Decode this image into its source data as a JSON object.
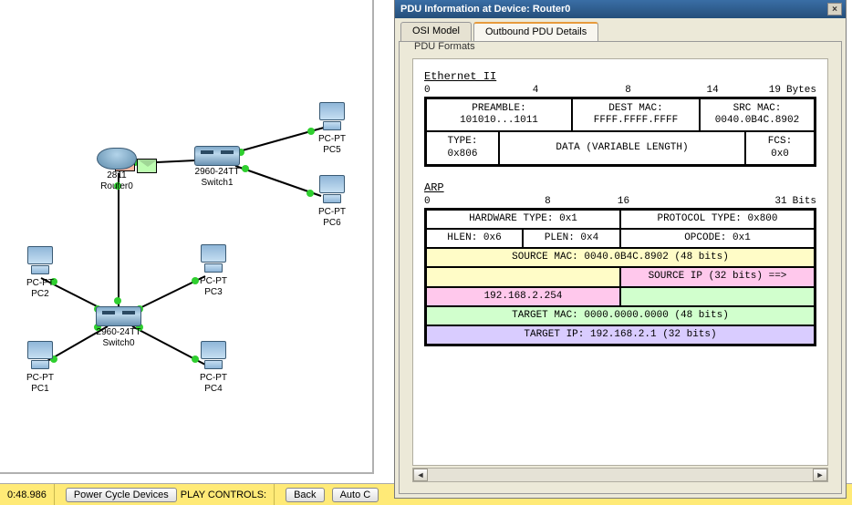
{
  "window": {
    "title": "PDU Information at Device: Router0",
    "close_glyph": "×"
  },
  "tabs": {
    "osi": "OSI Model",
    "outbound": "Outbound PDU Details"
  },
  "fieldset_label": "PDU Formats",
  "ethernet": {
    "title": "Ethernet II",
    "ticks": [
      "0",
      "4",
      "8",
      "14",
      "19"
    ],
    "unit": "Bytes",
    "preamble_label": "PREAMBLE:",
    "preamble_value": "101010...1011",
    "destmac_label": "DEST MAC:",
    "destmac_value": "FFFF.FFFF.FFFF",
    "srcmac_label": "SRC MAC:",
    "srcmac_value": "0040.0B4C.8902",
    "type_label": "TYPE:",
    "type_value": "0x806",
    "data_label": "DATA (VARIABLE LENGTH)",
    "fcs_label": "FCS:",
    "fcs_value": "0x0"
  },
  "arp": {
    "title": "ARP",
    "ticks": [
      "0",
      "8",
      "16",
      "31"
    ],
    "unit": "Bits",
    "hw_type": "HARDWARE TYPE: 0x1",
    "proto_type": "PROTOCOL TYPE: 0x800",
    "hlen": "HLEN: 0x6",
    "plen": "PLEN: 0x4",
    "opcode": "OPCODE: 0x1",
    "src_mac": "SOURCE MAC: 0040.0B4C.8902 (48 bits)",
    "src_ip_label": "SOURCE IP (32 bits) ==>",
    "src_ip": "192.168.2.254",
    "tgt_mac": "TARGET MAC: 0000.0000.0000 (48 bits)",
    "tgt_ip": "TARGET IP: 192.168.2.1 (32 bits)"
  },
  "topology": {
    "router": {
      "type": "2811",
      "name": "Router0"
    },
    "switch1": {
      "type": "2960-24TT",
      "name": "Switch1"
    },
    "switch0": {
      "type": "2960-24TT",
      "name": "Switch0"
    },
    "pc1": {
      "type": "PC-PT",
      "name": "PC1"
    },
    "pc2": {
      "type": "PC-PT",
      "name": "PC2"
    },
    "pc3": {
      "type": "PC-PT",
      "name": "PC3"
    },
    "pc4": {
      "type": "PC-PT",
      "name": "PC4"
    },
    "pc5": {
      "type": "PC-PT",
      "name": "PC5"
    },
    "pc6": {
      "type": "PC-PT",
      "name": "PC6"
    }
  },
  "bottombar": {
    "time": "0:48.986",
    "power": "Power Cycle Devices",
    "play_label": "PLAY CONTROLS:",
    "back": "Back",
    "auto": "Auto C"
  }
}
